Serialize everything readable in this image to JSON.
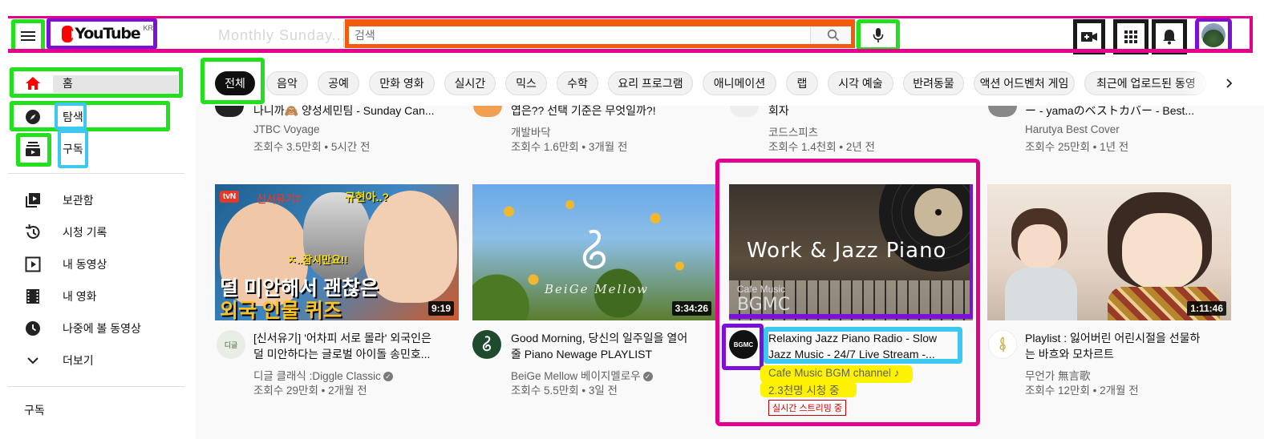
{
  "header": {
    "logo_text": "YouTube",
    "logo_region": "KR",
    "search_placeholder": "검색",
    "ghost_text": "Monthly Sunday..."
  },
  "sidebar": {
    "items": [
      {
        "label": "홈",
        "icon": "home-icon"
      },
      {
        "label": "탐색",
        "icon": "explore-icon"
      },
      {
        "label": "구독",
        "icon": "subscriptions-icon"
      },
      {
        "label": "보관함",
        "icon": "library-icon"
      },
      {
        "label": "시청 기록",
        "icon": "history-icon"
      },
      {
        "label": "내 동영상",
        "icon": "your-videos-icon"
      },
      {
        "label": "내 영화",
        "icon": "movies-icon"
      },
      {
        "label": "나중에 볼 동영상",
        "icon": "watch-later-icon"
      },
      {
        "label": "더보기",
        "icon": "chevron-down-icon"
      }
    ],
    "section_title": "구독"
  },
  "chips": [
    "전체",
    "음악",
    "공예",
    "만화 영화",
    "실시간",
    "믹스",
    "수학",
    "요리 프로그램",
    "애니메이션",
    "랩",
    "시각 예술",
    "반려동물",
    "액션 어드벤처 게임",
    "최근에 업로드된 동영"
  ],
  "top_row": [
    {
      "title": "나니까🙈 양성세민팀 - Sunday Can...",
      "channel": "JTBC Voyage",
      "meta": "조회수 3.5만회 • 5시간 전"
    },
    {
      "title": "엽은?? 선택 기준은 무엇일까?!",
      "channel": "개발바닥",
      "meta": "조회수 1.6만회 • 3개월 전"
    },
    {
      "title": "회자",
      "channel": "코드스피츠",
      "meta": "조회수 1.4천회 • 2년 전"
    },
    {
      "title": "ー - yamaのベストカバー - Best...",
      "channel": "Harutya Best Cover",
      "meta": "조회수 25만회 • 1년 전"
    }
  ],
  "videos": [
    {
      "title_line1": "[신서유기] '어차피 서로 몰라' 외국인은",
      "title_line2": "덜 미안하다는 글로벌 아이돌 송민호...",
      "channel": "디글 클래식 :Diggle Classic",
      "meta": "조회수 29만회 • 2개월 전",
      "duration": "9:19",
      "thumb_text_top": "신서유기7",
      "thumb_text_q": "규현아..?",
      "thumb_text_mid": "ㅈ..잠시만요!!",
      "thumb_text_main1": "덜 미안해서 괜찮은",
      "thumb_text_main2": "외국 인물 퀴즈",
      "thumb_badge": "tvN",
      "avatar_text": "디글"
    },
    {
      "title_line1": "Good Morning, 당신의 일주일을 열어",
      "title_line2": "줄 Piano Newage PLAYLIST",
      "channel": "BeiGe Mellow 베이지멜로우",
      "meta": "조회수 5.5만회 • 3일 전",
      "duration": "3:34:26",
      "thumb_brand": "BeiGe Mellow"
    },
    {
      "title_line1": "Relaxing Jazz Piano Radio - Slow",
      "title_line2": "Jazz Music - 24/7 Live Stream -...",
      "channel": "Cafe Music BGM channel ♪",
      "meta": "2.3천명 시청 중",
      "live_badge": "실시간 스트리밍 중",
      "thumb_title": "Work & Jazz Piano",
      "thumb_sub1": "Cafe Music",
      "thumb_sub2": "BGMC",
      "avatar_text": "BGMC"
    },
    {
      "title_line1": "Playlist : 잃어버린 어린시절을 선물하",
      "title_line2": "는 바흐와 모차르트",
      "channel": "무언가 無言歌",
      "meta": "조회수 12만회 • 2개월 전",
      "duration": "1:11:46"
    }
  ],
  "colors": {
    "annotation_green": "#22e01c",
    "annotation_purple": "#7b10d6",
    "annotation_magenta": "#e4008f",
    "annotation_orange": "#f25a0c",
    "annotation_cyan": "#3cc8f0",
    "annotation_yellow": "#fff200",
    "youtube_red": "#ff0000"
  }
}
